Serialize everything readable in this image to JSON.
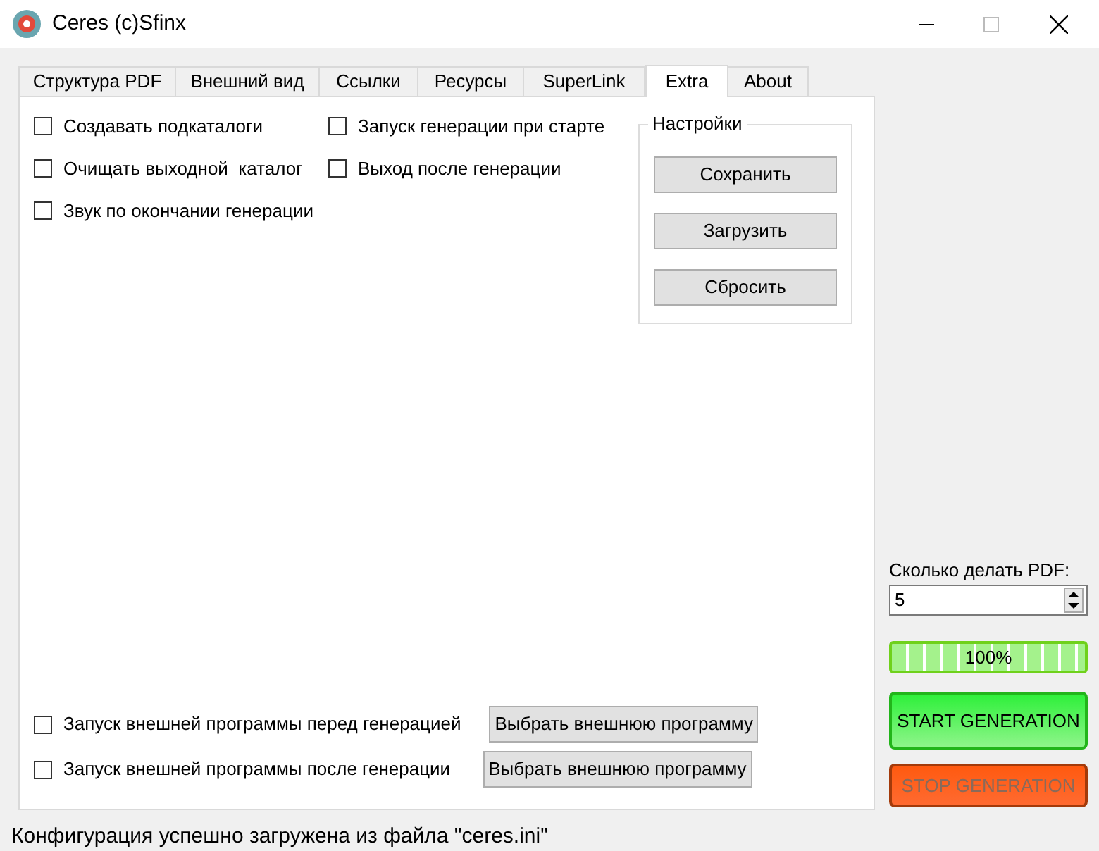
{
  "window": {
    "title": "Ceres (c)Sfinx"
  },
  "tabs": [
    {
      "label": "Структура PDF",
      "selected": false
    },
    {
      "label": "Внешний вид",
      "selected": false
    },
    {
      "label": "Ссылки",
      "selected": false
    },
    {
      "label": "Ресурсы",
      "selected": false
    },
    {
      "label": "SuperLink",
      "selected": false
    },
    {
      "label": "Extra",
      "selected": true
    },
    {
      "label": "About",
      "selected": false
    }
  ],
  "options_left": [
    {
      "label": "Создавать подкаталоги",
      "checked": false
    },
    {
      "label": "Очищать выходной  каталог",
      "checked": false
    },
    {
      "label": "Звук по окончании генерации",
      "checked": false
    }
  ],
  "options_right": [
    {
      "label": "Запуск генерации при старте",
      "checked": false
    },
    {
      "label": "Выход после генерации",
      "checked": false
    }
  ],
  "settings": {
    "title": "Настройки",
    "buttons": [
      "Сохранить",
      "Загрузить",
      "Сбросить"
    ]
  },
  "external": [
    {
      "label": "Запуск внешней программы перед генерацией",
      "checked": false,
      "button": "Выбрать внешнюю программу"
    },
    {
      "label": "Запуск внешней программы после генерации",
      "checked": false,
      "button": "Выбрать внешнюю программу"
    }
  ],
  "count": {
    "label": "Сколько делать PDF:",
    "value": "5"
  },
  "progress": {
    "level": 1,
    "reading": "100%"
  },
  "actions": [
    {
      "label": "START GENERATION",
      "kind": "start",
      "disabled": false
    },
    {
      "label": "STOP GENERATION",
      "kind": "stop",
      "disabled": true
    }
  ],
  "status_bar": "Конфигурация успешно загружена из файла \"ceres.ini\""
}
